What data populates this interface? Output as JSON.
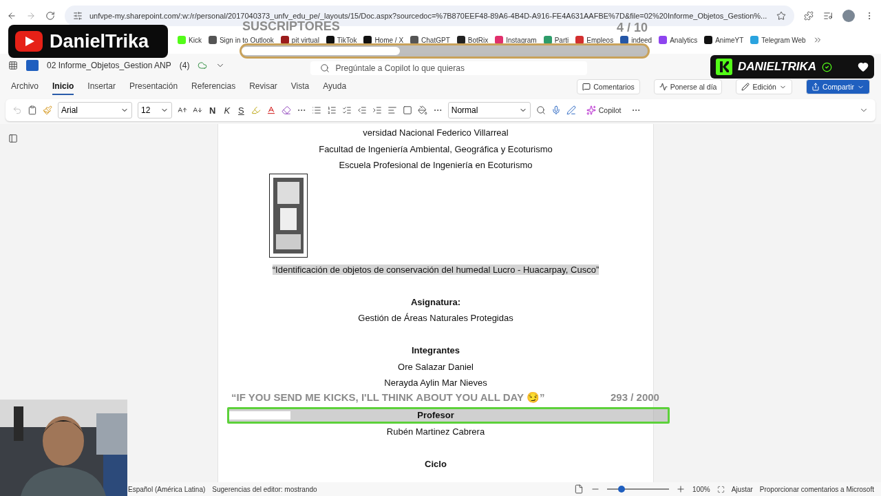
{
  "browser": {
    "url": "unfvpe-my.sharepoint.com/:w:/r/personal/2017040373_unfv_edu_pe/_layouts/15/Doc.aspx?sourcedoc=%7B870EEF48-89A6-4B4D-A916-FE4A631AAFBE%7D&file=02%20Informe_Objetos_Gestion%...",
    "bookmarks": [
      {
        "label": "Kick",
        "color": "#53fc18"
      },
      {
        "label": "Sign in to Outlook",
        "color": "#555555"
      },
      {
        "label": "pit virtual",
        "color": "#9b1c1c"
      },
      {
        "label": "TikTok",
        "color": "#111111"
      },
      {
        "label": "Home / X",
        "color": "#111111"
      },
      {
        "label": "ChatGPT",
        "color": "#555555"
      },
      {
        "label": "BotRix",
        "color": "#222222"
      },
      {
        "label": "Instagram",
        "color": "#e1306c"
      },
      {
        "label": "Parti",
        "color": "#2e9c6a"
      },
      {
        "label": "Empleos",
        "color": "#d32f2f"
      },
      {
        "label": "indeed",
        "color": "#2557a7"
      },
      {
        "label": "Analytics",
        "color": "#8e44ef"
      },
      {
        "label": "AnimeYT",
        "color": "#111111"
      },
      {
        "label": "Telegram Web",
        "color": "#2aa3df"
      }
    ]
  },
  "word": {
    "doc_title": "02 Informe_Objetos_Gestion ANP",
    "version": "(4)",
    "search_placeholder": "Pregúntale a Copilot lo que quieras"
  },
  "tabs": [
    {
      "label": "Archivo",
      "selected": false
    },
    {
      "label": "Inicio",
      "selected": true
    },
    {
      "label": "Insertar",
      "selected": false
    },
    {
      "label": "Presentación",
      "selected": false
    },
    {
      "label": "Referencias",
      "selected": false
    },
    {
      "label": "Revisar",
      "selected": false
    },
    {
      "label": "Vista",
      "selected": false
    },
    {
      "label": "Ayuda",
      "selected": false
    }
  ],
  "actions": [
    {
      "label": "Comentarios",
      "kind": "comment"
    },
    {
      "label": "Ponerse al día",
      "kind": "catchup"
    },
    {
      "label": "Edición",
      "kind": "edit"
    },
    {
      "label": "Compartir",
      "kind": "share"
    }
  ],
  "toolbar": {
    "font": "Arial",
    "size": "12",
    "bold": "N",
    "italic": "K",
    "strike": "S",
    "style": "Normal",
    "copilot": "Copilot"
  },
  "document": [
    {
      "kind": "text",
      "text": "versidad Nacional Federico Villarreal"
    },
    {
      "kind": "text",
      "text": "Facultad de Ingeniería Ambiental, Geográfica y Ecoturismo"
    },
    {
      "kind": "text",
      "text": "Escuela Profesional de Ingeniería en Ecoturismo"
    },
    {
      "kind": "emblem"
    },
    {
      "kind": "highlight",
      "text": "“Identificación de objetos de conservación del humedal Lucro - Huacarpay, Cusco”"
    },
    {
      "kind": "blank"
    },
    {
      "kind": "heading",
      "text": "Asignatura:"
    },
    {
      "kind": "text",
      "text": "Gestión de Áreas Naturales Protegidas"
    },
    {
      "kind": "blank"
    },
    {
      "kind": "heading",
      "text": "Integrantes"
    },
    {
      "kind": "text",
      "text": "Ore Salazar Daniel"
    },
    {
      "kind": "text",
      "text": "Nerayda Aylin Mar Nieves"
    },
    {
      "kind": "blank"
    },
    {
      "kind": "heading",
      "text": "Profesor"
    },
    {
      "kind": "text",
      "text": "Rubén Martinez Cabrera"
    },
    {
      "kind": "blank"
    },
    {
      "kind": "heading",
      "text": "Ciclo"
    }
  ],
  "status_bar": {
    "language": "Español (América Latina)",
    "suggestions": "Sugerencias del editor: mostrando",
    "zoom": "100%",
    "zoom_level": {
      "level": 0.23
    },
    "fit": "Ajustar",
    "feedback": "Proporcionar comentarios a Microsoft"
  },
  "overlays": {
    "youtube_channel": "DanielTrika",
    "kick_channel": "DANIELTRIKA",
    "subs_goal": {
      "label": "SUSCRIPTORES",
      "count": "4",
      "total": "/ 10",
      "level": 0.39
    },
    "kicks_goal": {
      "message": "“IF YOU SEND ME KICKS, I'LL THINK ABOUT YOU ALL DAY 😏”",
      "count": "293",
      "total": "/ 2000",
      "level": 0.14
    }
  }
}
